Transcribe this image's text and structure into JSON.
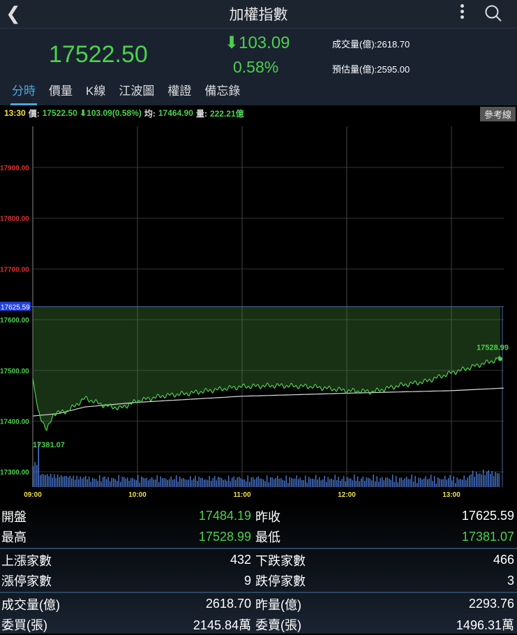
{
  "header": {
    "title": "加權指數",
    "back_icon": "chevron-left-icon",
    "more_icon": "more-vertical-icon",
    "search_icon": "search-icon"
  },
  "quote": {
    "price": "17522.50",
    "change": "⬇103.09",
    "percent": "0.58%",
    "volume": "成交量(億):2618.70",
    "est_volume": "預估量(億):2595.00",
    "down_color": "#4cd14c"
  },
  "tabs": [
    {
      "label": "分時",
      "active": true
    },
    {
      "label": "價量"
    },
    {
      "label": "K線"
    },
    {
      "label": "江波圖"
    },
    {
      "label": "權證"
    },
    {
      "label": "備忘錄"
    }
  ],
  "info": {
    "time": "13:30",
    "price_label": "價:",
    "price": "17522.50 ⬇103.09(0.58%)",
    "avg_label": "均:",
    "avg": "17464.90",
    "vol_label": "量:",
    "vol": "222.21億",
    "ref_button": "參考線"
  },
  "chart_data": {
    "type": "line",
    "x_ticks": [
      "09:00",
      "10:00",
      "11:00",
      "12:00",
      "13:00"
    ],
    "y_ticks": [
      "17900.00",
      "17800.00",
      "17700.00",
      "17600.00",
      "17500.00",
      "17400.00",
      "17300.00"
    ],
    "y_tick_values": [
      17900,
      17800,
      17700,
      17600,
      17500,
      17400,
      17300
    ],
    "ylim": [
      17270,
      17992
    ],
    "reference": 17625.59,
    "reference_label": "17625.59",
    "high_label": "17528.99",
    "low_label": "17381.07",
    "price_anchors": [
      [
        0,
        17484
      ],
      [
        3,
        17420
      ],
      [
        8,
        17381
      ],
      [
        12,
        17415
      ],
      [
        20,
        17420
      ],
      [
        30,
        17445
      ],
      [
        40,
        17432
      ],
      [
        50,
        17425
      ],
      [
        60,
        17440
      ],
      [
        75,
        17450
      ],
      [
        90,
        17455
      ],
      [
        105,
        17462
      ],
      [
        120,
        17468
      ],
      [
        140,
        17470
      ],
      [
        160,
        17468
      ],
      [
        180,
        17460
      ],
      [
        195,
        17458
      ],
      [
        210,
        17470
      ],
      [
        225,
        17478
      ],
      [
        240,
        17495
      ],
      [
        255,
        17510
      ],
      [
        265,
        17520
      ],
      [
        268,
        17528.99
      ],
      [
        270,
        17522.5
      ]
    ],
    "avg_anchors": [
      [
        0,
        17410
      ],
      [
        15,
        17415
      ],
      [
        30,
        17428
      ],
      [
        60,
        17437
      ],
      [
        120,
        17449
      ],
      [
        180,
        17455
      ],
      [
        240,
        17460
      ],
      [
        270,
        17465
      ]
    ]
  },
  "stats": [
    [
      {
        "label": "開盤",
        "value": "17484.19",
        "green": true
      },
      {
        "label": "昨收",
        "value": "17625.59"
      }
    ],
    [
      {
        "label": "最高",
        "value": "17528.99",
        "green": true
      },
      {
        "label": "最低",
        "value": "17381.07",
        "green": true
      }
    ],
    "sep",
    [
      {
        "label": "上漲家數",
        "value": "432"
      },
      {
        "label": "下跌家數",
        "value": "466"
      }
    ],
    [
      {
        "label": "漲停家數",
        "value": "9"
      },
      {
        "label": "跌停家數",
        "value": "3"
      }
    ],
    "sep",
    [
      {
        "label": "成交量(億)",
        "value": "2618.70"
      },
      {
        "label": "昨量(億)",
        "value": "2293.76"
      }
    ],
    [
      {
        "label": "委買(張)",
        "value": "2145.84萬"
      },
      {
        "label": "委賣(張)",
        "value": "1496.31萬"
      }
    ]
  ]
}
